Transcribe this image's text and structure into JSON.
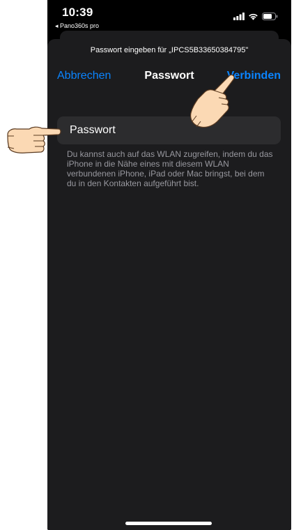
{
  "status_bar": {
    "time": "10:39",
    "back_app": "◂ Pano360s pro",
    "icons": [
      "signal-icon",
      "wifi-icon",
      "battery-icon"
    ]
  },
  "dialog": {
    "prompt": "Passwort eingeben für „IPCS5B33650384795\"",
    "cancel_label": "Abbrechen",
    "title": "Passwort",
    "connect_label": "Verbinden",
    "password_placeholder": "Passwort",
    "password_value": "",
    "hint": "Du kannst auch auf das WLAN zugreifen, indem du das iPhone in die Nähe eines mit diesem WLAN verbundenen iPhone, iPad oder Mac bringst, bei dem du in den Kontakten aufgeführt bist."
  },
  "colors": {
    "accent": "#0a84ff",
    "sheet": "#1c1c1e",
    "field": "#2c2c2e",
    "hint_text": "#98989f"
  }
}
